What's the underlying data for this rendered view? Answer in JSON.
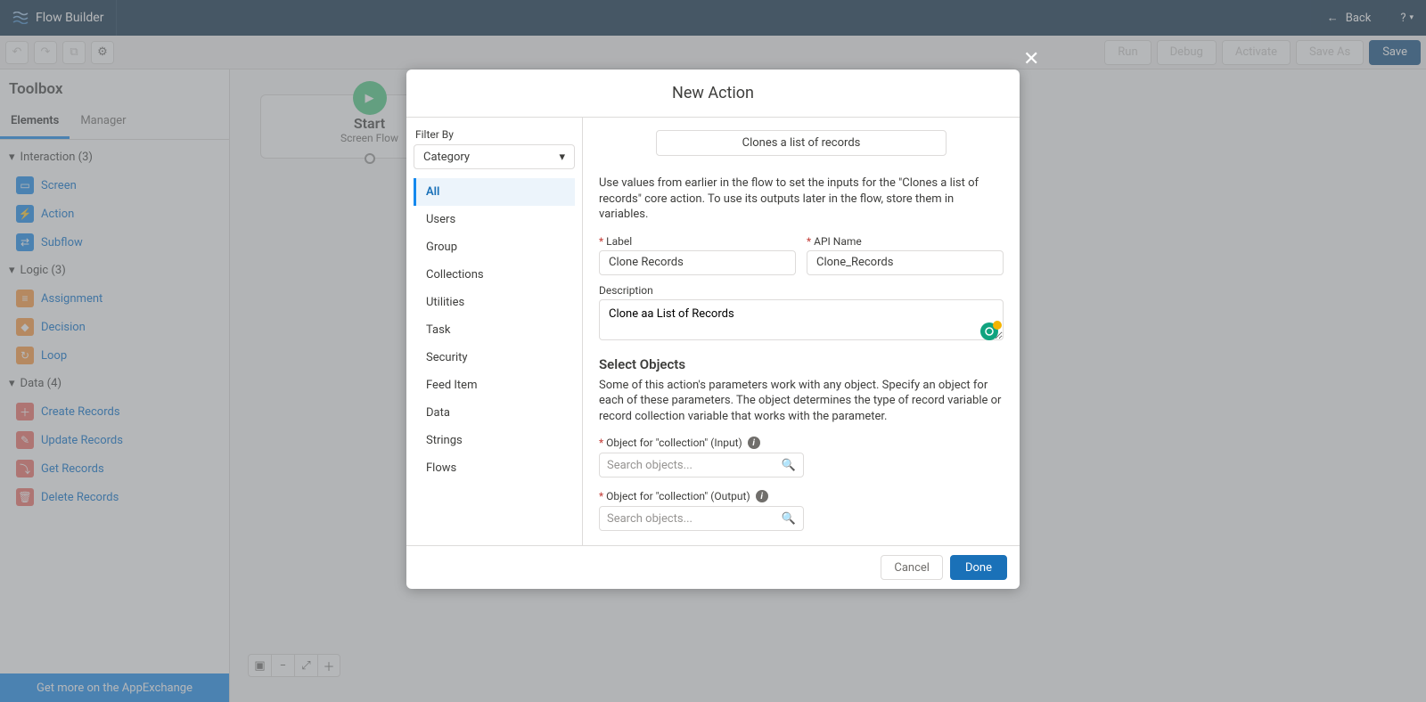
{
  "header": {
    "title": "Flow Builder",
    "back_label": "Back"
  },
  "actionbar": {
    "run": "Run",
    "debug": "Debug",
    "activate": "Activate",
    "save_as": "Save As",
    "save": "Save"
  },
  "sidebar": {
    "title": "Toolbox",
    "tabs": {
      "elements": "Elements",
      "manager": "Manager"
    },
    "groups": {
      "interaction": {
        "label": "Interaction (3)",
        "items": [
          "Screen",
          "Action",
          "Subflow"
        ]
      },
      "logic": {
        "label": "Logic (3)",
        "items": [
          "Assignment",
          "Decision",
          "Loop"
        ]
      },
      "data": {
        "label": "Data (4)",
        "items": [
          "Create Records",
          "Update Records",
          "Get Records",
          "Delete Records"
        ]
      }
    },
    "app_exchange": "Get more on the AppExchange"
  },
  "start_node": {
    "title": "Start",
    "subtitle": "Screen Flow"
  },
  "modal": {
    "title": "New Action",
    "filter_by_label": "Filter By",
    "filter_by_value": "Category",
    "categories": [
      "All",
      "Users",
      "Group",
      "Collections",
      "Utilities",
      "Task",
      "Security",
      "Feed Item",
      "Data",
      "Strings",
      "Flows"
    ],
    "action_name": "Clones a list of records",
    "help_text": "Use values from earlier in the flow to set the inputs for the \"Clones a list of records\" core action. To use its outputs later in the flow, store them in variables.",
    "label_label": "Label",
    "label_value": "Clone Records",
    "api_name_label": "API Name",
    "api_name_value": "Clone_Records",
    "description_label": "Description",
    "description_value": "Clone aa List of Records",
    "select_objects_title": "Select Objects",
    "select_objects_help": "Some of this action's parameters work with any object. Specify an object for each of these parameters. The object determines the type of record variable or record collection variable that works with the parameter.",
    "obj_input_label": "Object for \"collection\" (Input)",
    "obj_output_label": "Object for \"collection\" (Output)",
    "search_placeholder": "Search objects...",
    "cancel": "Cancel",
    "done": "Done"
  }
}
